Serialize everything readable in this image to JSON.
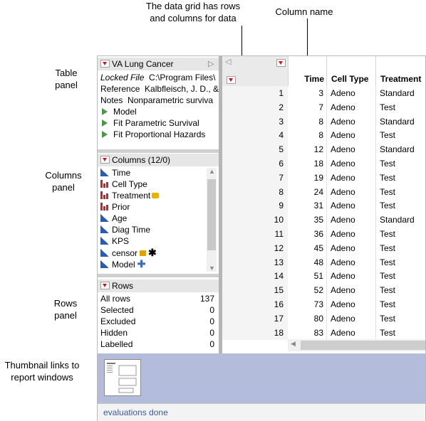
{
  "annotations": {
    "data_grid": "The data grid has rows and columns for data",
    "column_name": "Column name",
    "table_panel": "Table panel",
    "columns_panel": "Columns panel",
    "rows_panel": "Rows panel",
    "thumbnail_links": "Thumbnail links to report windows"
  },
  "table_panel": {
    "title": "VA Lung Cancer",
    "locked_label": "Locked File",
    "locked_value": "C:\\Program Files\\",
    "reference_label": "Reference",
    "reference_value": "Kalbfleisch, J. D., &",
    "notes_label": "Notes",
    "notes_value": "Nonparametric surviva",
    "scripts": [
      "Model",
      "Fit Parametric Survival",
      "Fit Proportional Hazards"
    ]
  },
  "columns_panel": {
    "title": "Columns (12/0)",
    "items": [
      {
        "name": "Time",
        "type": "continuous"
      },
      {
        "name": "Cell Type",
        "type": "nominal"
      },
      {
        "name": "Treatment",
        "type": "nominal"
      },
      {
        "name": "Prior",
        "type": "nominal"
      },
      {
        "name": "Age",
        "type": "continuous"
      },
      {
        "name": "Diag Time",
        "type": "continuous"
      },
      {
        "name": "KPS",
        "type": "continuous"
      },
      {
        "name": "censor",
        "type": "continuous"
      },
      {
        "name": "Model",
        "type": "continuous"
      }
    ]
  },
  "rows_panel": {
    "title": "Rows",
    "items": [
      {
        "label": "All rows",
        "value": "137"
      },
      {
        "label": "Selected",
        "value": "0"
      },
      {
        "label": "Excluded",
        "value": "0"
      },
      {
        "label": "Hidden",
        "value": "0"
      },
      {
        "label": "Labelled",
        "value": "0"
      }
    ]
  },
  "grid": {
    "headers": [
      "Time",
      "Cell Type",
      "Treatment"
    ],
    "rows": [
      [
        "1",
        "3",
        "Adeno",
        "Standard"
      ],
      [
        "2",
        "7",
        "Adeno",
        "Test"
      ],
      [
        "3",
        "8",
        "Adeno",
        "Standard"
      ],
      [
        "4",
        "8",
        "Adeno",
        "Test"
      ],
      [
        "5",
        "12",
        "Adeno",
        "Standard"
      ],
      [
        "6",
        "18",
        "Adeno",
        "Test"
      ],
      [
        "7",
        "19",
        "Adeno",
        "Test"
      ],
      [
        "8",
        "24",
        "Adeno",
        "Test"
      ],
      [
        "9",
        "31",
        "Adeno",
        "Test"
      ],
      [
        "10",
        "35",
        "Adeno",
        "Standard"
      ],
      [
        "11",
        "36",
        "Adeno",
        "Test"
      ],
      [
        "12",
        "45",
        "Adeno",
        "Test"
      ],
      [
        "13",
        "48",
        "Adeno",
        "Test"
      ],
      [
        "14",
        "51",
        "Adeno",
        "Test"
      ],
      [
        "15",
        "52",
        "Adeno",
        "Test"
      ],
      [
        "16",
        "73",
        "Adeno",
        "Test"
      ],
      [
        "17",
        "80",
        "Adeno",
        "Test"
      ],
      [
        "18",
        "83",
        "Adeno",
        "Test"
      ]
    ]
  },
  "status": "evaluations done",
  "colors": {
    "accent_red": "#d0161e",
    "thumb_bg": "#b3bddb",
    "status_text": "#3f5a92"
  }
}
